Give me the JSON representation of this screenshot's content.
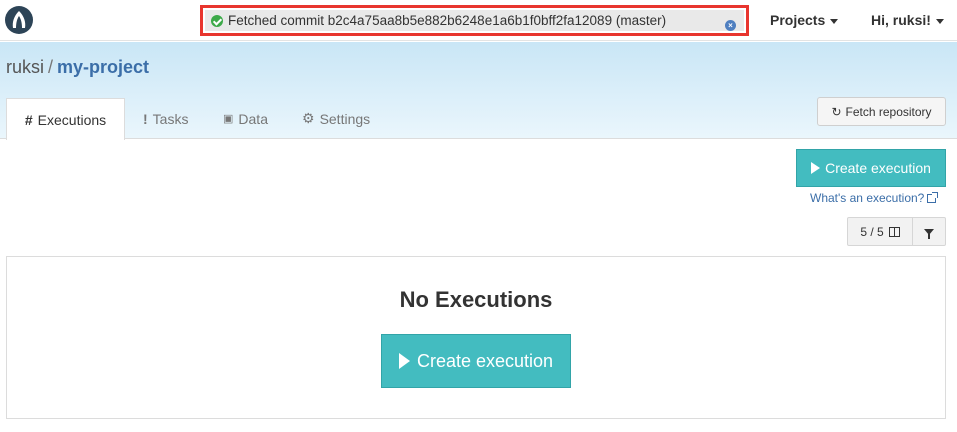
{
  "topbar": {
    "logo_icon": "valohai-logo-icon",
    "toast": {
      "message": "Fetched commit b2c4a75aa8b5e882b6248e1a6b1f0bff2fa12089 (master)",
      "status_color": "#3daa4a",
      "close_icon": "close-icon"
    },
    "projects_label": "Projects",
    "user_label": "Hi, ruksi!"
  },
  "breadcrumb": {
    "owner": "ruksi",
    "separator": "/",
    "project": "my-project"
  },
  "tabs": [
    {
      "icon": "#",
      "label": "Executions",
      "active": true
    },
    {
      "icon": "!",
      "label": "Tasks",
      "active": false
    },
    {
      "icon": "💾",
      "label": "Data",
      "active": false
    },
    {
      "icon": "⚙",
      "label": "Settings",
      "active": false
    }
  ],
  "fetch_button": {
    "icon": "↻",
    "label": "Fetch repository"
  },
  "main": {
    "create_button_label": "Create execution",
    "help_link": "What's an execution?",
    "columns_label": "5 / 5",
    "empty_title": "No Executions",
    "empty_create_label": "Create execution"
  },
  "colors": {
    "accent": "#43bcc0",
    "link": "#3b6ea8",
    "toast_border": "#e8352e"
  }
}
